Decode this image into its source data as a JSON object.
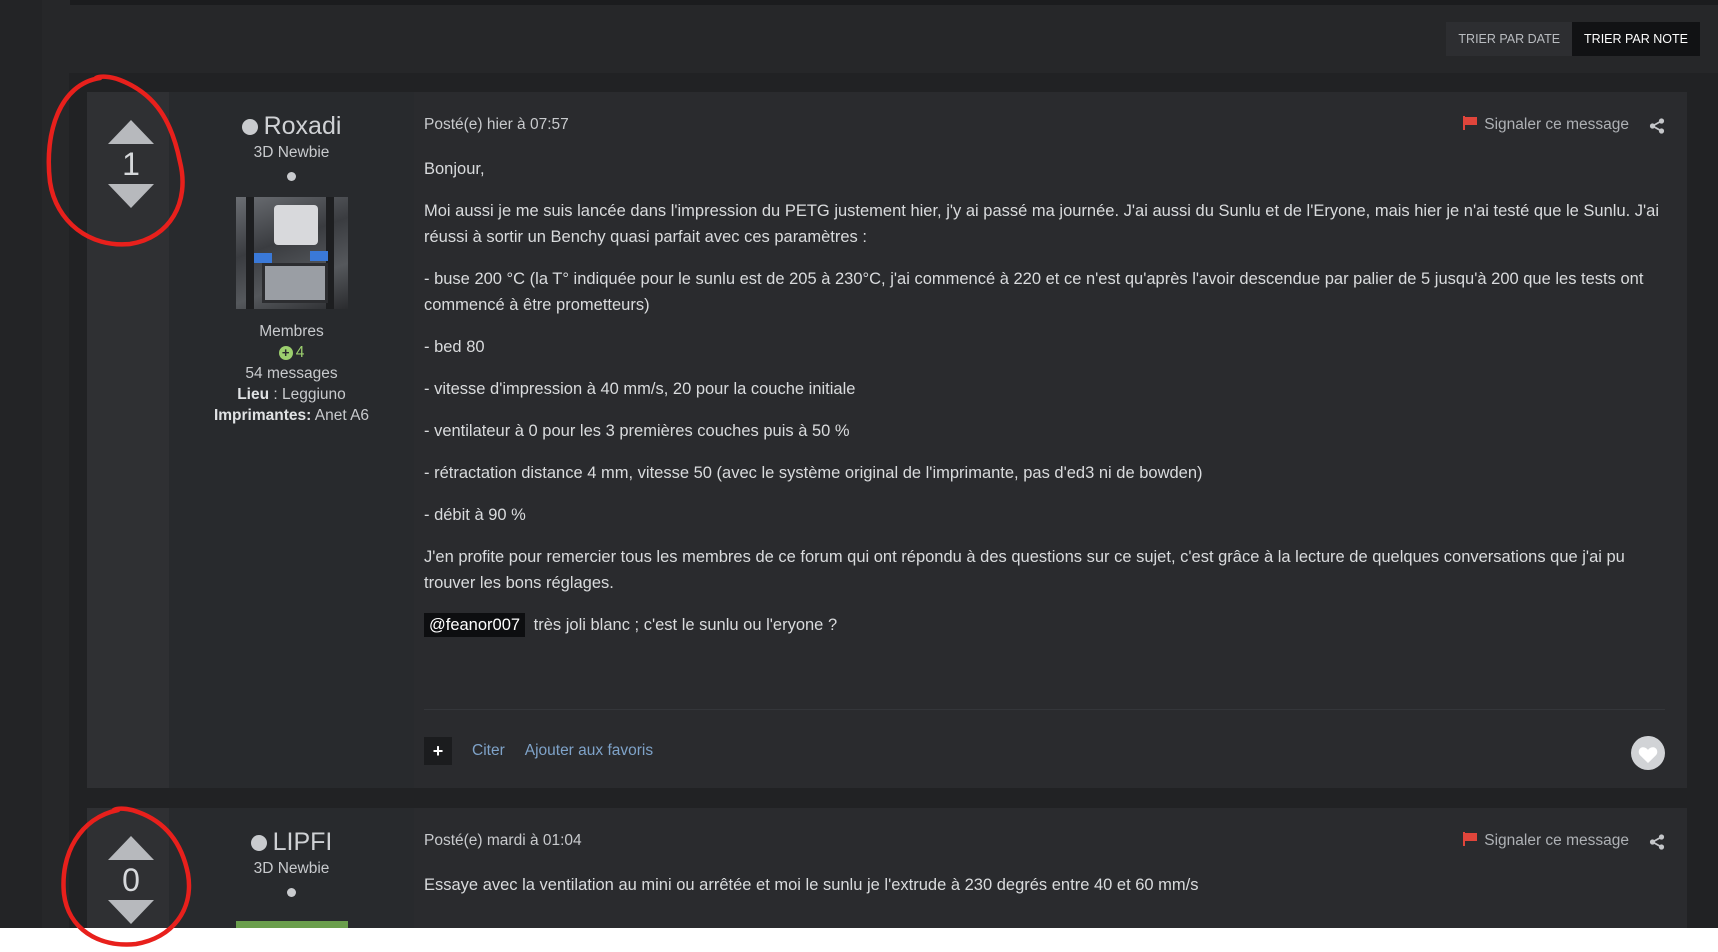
{
  "sort": {
    "by_date": "TRIER PAR DATE",
    "by_note": "TRIER PAR NOTE"
  },
  "posts": [
    {
      "votes": "1",
      "author": "Roxadi",
      "rank": "3D Newbie",
      "group": "Membres",
      "reputation": "4",
      "message_count": "54 messages",
      "location_label": "Lieu",
      "location_sep": " : Leggiuno",
      "printer_label": "Imprimantes:",
      "printer_value": " Anet A6",
      "posted": "Posté(e) hier à 07:57",
      "report": "Signaler ce message",
      "paragraphs": [
        "Bonjour,",
        "Moi aussi je me suis lancée dans l'impression du PETG justement hier, j'y ai passé ma journée. J'ai aussi du Sunlu et de l'Eryone, mais hier je n'ai testé que le Sunlu. J'ai réussi à sortir un Benchy quasi parfait avec ces paramètres :",
        "- buse 200 °C (la T° indiquée pour le sunlu est de 205 à 230°C, j'ai commencé à 220 et ce n'est qu'après l'avoir descendue par palier de 5 jusqu'à 200 que les tests ont commencé à être prometteurs)",
        "- bed 80",
        "- vitesse d'impression à 40 mm/s, 20 pour la couche initiale",
        "- ventilateur à 0 pour les 3 premières couches puis à 50 %",
        "- rétractation distance 4 mm, vitesse 50 (avec le système original de l'imprimante, pas d'ed3 ni de bowden)",
        "- débit à 90 %",
        "J'en profite pour remercier tous les membres de ce forum qui ont répondu à des questions sur ce sujet, c'est grâce à la lecture de quelques conversations que j'ai pu trouver les bons réglages."
      ],
      "mention": "@feanor007",
      "mention_text": " très joli blanc ; c'est le sunlu ou l'eryone ?",
      "actions": {
        "quote": "Citer",
        "favorite": "Ajouter aux favoris"
      }
    },
    {
      "votes": "0",
      "author": "LIPFI",
      "rank": "3D Newbie",
      "posted": "Posté(e) mardi à 01:04",
      "report": "Signaler ce message",
      "body": "Essaye avec la ventilation au mini ou arrêtée et moi le sunlu je l'extrude à 230 degrés entre 40 et 60 mm/s"
    }
  ],
  "icons": {
    "plus": "+",
    "flag": "flag-icon",
    "share": "share-icon",
    "like": "heart-icon",
    "rep": "plus-circle-icon"
  },
  "colors": {
    "background": "#262729",
    "post": "#2a2b2e",
    "link": "#7fa3c9",
    "reputation": "#9ccf6e",
    "flag": "#e0453b",
    "annotation": "#e8201c"
  }
}
